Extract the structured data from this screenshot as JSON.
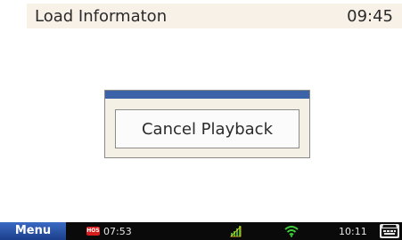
{
  "header": {
    "title": "Load Informaton",
    "time": "09:45"
  },
  "dialog": {
    "button_label": "Cancel Playback"
  },
  "taskbar": {
    "menu_label": "Menu",
    "hos_badge": "HOS",
    "hos_time": "07:53",
    "signal_icon": "signal-bars-icon",
    "wifi_icon": "wifi-icon",
    "clock": "10:11",
    "keyboard_icon": "keyboard-icon"
  },
  "colors": {
    "header_bg": "#f7f1e8",
    "dialog_bar": "#3c63a8",
    "taskbar_bg": "#0a0a0a",
    "menu_button": "#2a54a8",
    "hos_badge": "#d61e1e",
    "signal_green": "#3fae2a",
    "wifi_green": "#3fcf3a"
  }
}
